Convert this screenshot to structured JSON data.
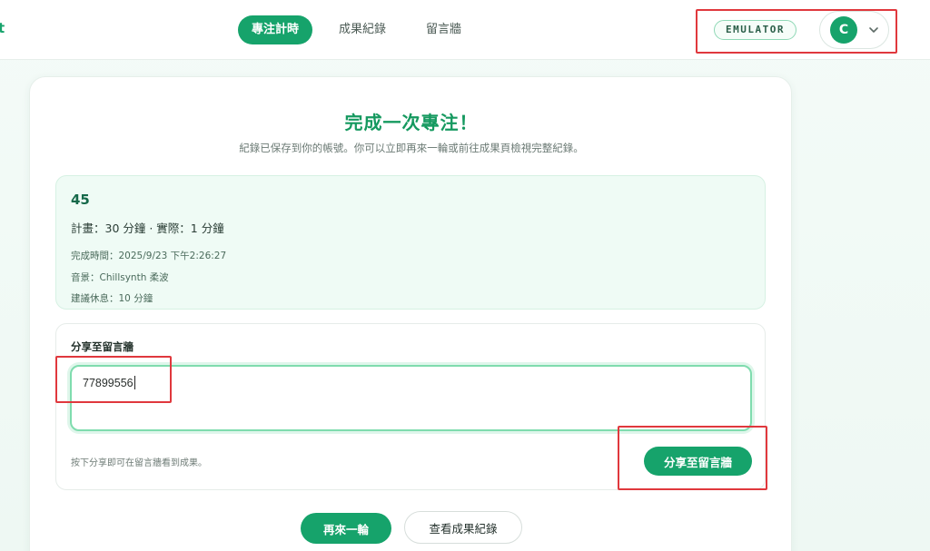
{
  "header": {
    "brand_fragment": "t",
    "nav": [
      {
        "label": "專注計時",
        "active": true
      },
      {
        "label": "成果紀錄",
        "active": false
      },
      {
        "label": "留言牆",
        "active": false
      }
    ],
    "emulator_badge": "EMULATOR",
    "user_initial": "C"
  },
  "completion": {
    "title": "完成一次專注！",
    "subtitle": "紀錄已保存到你的帳號。你可以立即再來一輪或前往成果頁檢視完整紀錄。",
    "summary": {
      "minutes": "45",
      "plan_actual": "計畫：30 分鐘 · 實際：1 分鐘",
      "completed_at": "完成時間：2025/9/23 下午2:26:27",
      "music": "音景：Chillsynth 柔波",
      "suggested_break": "建議休息：10 分鐘"
    },
    "share": {
      "label": "分享至留言牆",
      "input_value": "77899556",
      "hint": "按下分享即可在留言牆看到成果。",
      "button": "分享至留言牆"
    },
    "actions": {
      "again": "再來一輪",
      "view_records": "查看成果紀錄"
    }
  },
  "colors": {
    "accent": "#16a36b",
    "annotation": "#e0383d"
  },
  "icons": {
    "user_menu": "chevron-down-icon"
  }
}
